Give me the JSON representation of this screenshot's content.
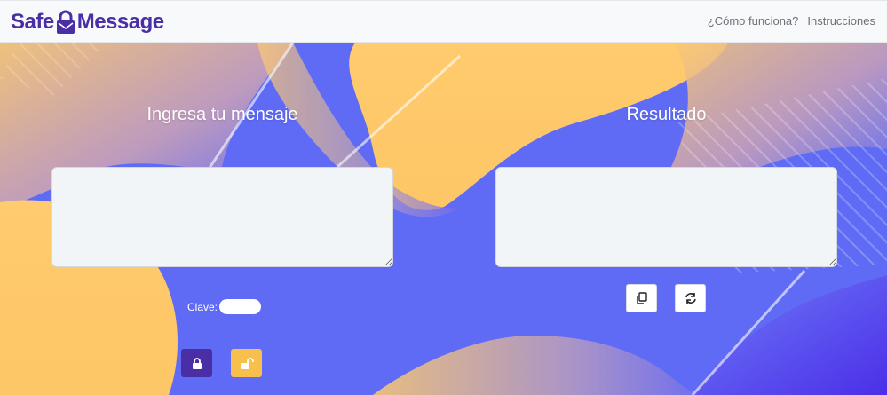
{
  "brand": {
    "name_part1": "Safe",
    "name_part2": "Message",
    "color": "#4a2ea6"
  },
  "nav": {
    "how_it_works": "¿Cómo funciona?",
    "instructions": "Instrucciones"
  },
  "input_section": {
    "title": "Ingresa tu mensaje",
    "message_value": "",
    "key_label": "Clave:",
    "key_value": ""
  },
  "result_section": {
    "title": "Resultado",
    "result_value": ""
  },
  "buttons": {
    "encrypt_icon": "lock-icon",
    "decrypt_icon": "unlock-icon",
    "copy_icon": "copy-icon",
    "refresh_icon": "refresh-icon"
  },
  "colors": {
    "hero_blue": "#5f6bf5",
    "accent_yellow": "#f7bf4b",
    "accent_purple": "#4a2ea6"
  }
}
